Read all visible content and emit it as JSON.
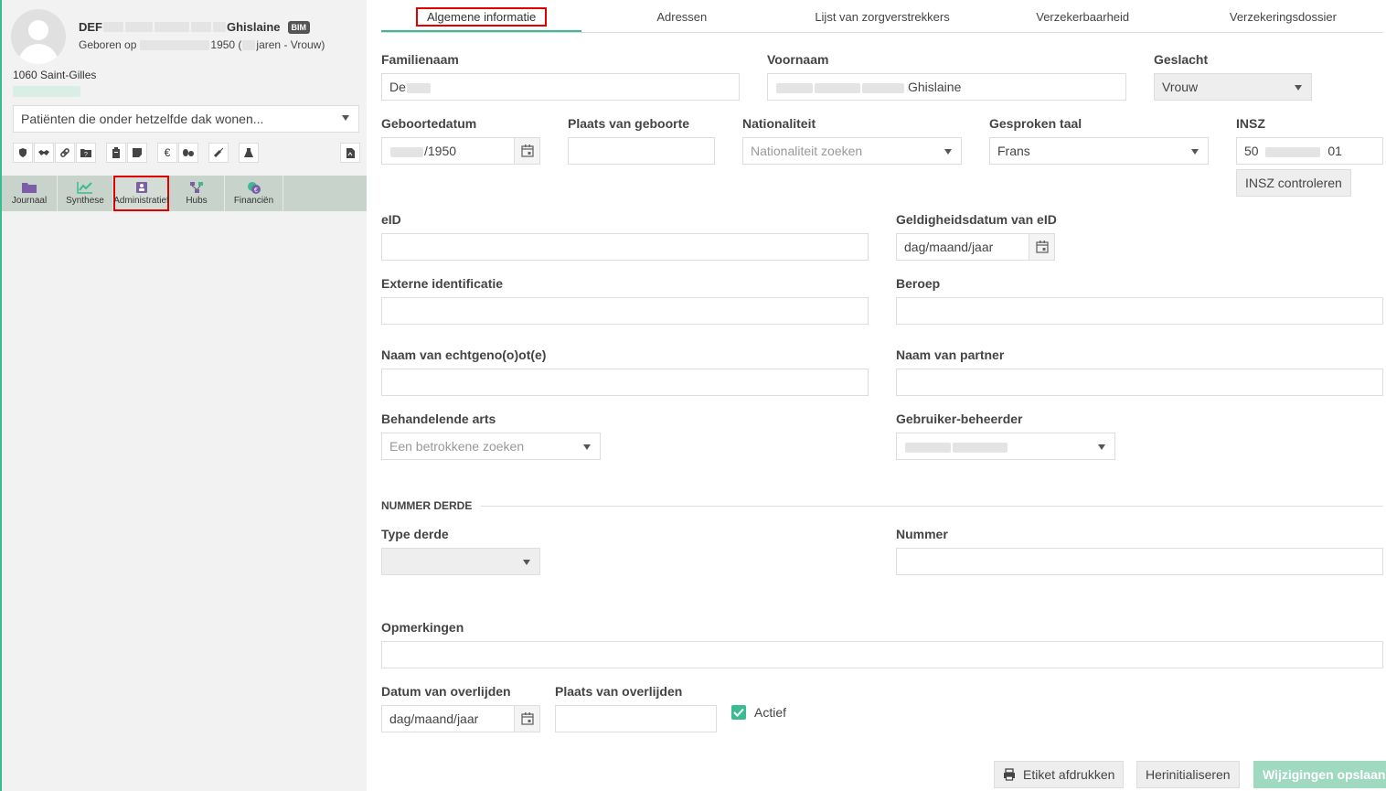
{
  "patient": {
    "name_prefix": "DEF",
    "name_suffix": "Ghislaine",
    "badge": "BIM",
    "birth_prefix": "Geboren op",
    "birth_year": "1950 (",
    "birth_suffix": "jaren - Vrouw)",
    "address": "1060 Saint-Gilles",
    "household_select": "Patiënten die onder hetzelfde dak wonen..."
  },
  "toolbar_icons": [
    "shield-icon",
    "handshake-icon",
    "link-icon",
    "folder-question-icon",
    "clipboard-icon",
    "sticky-note-icon",
    "euro-icon",
    "pills-icon",
    "syringe-icon",
    "flask-icon",
    "pdf-icon"
  ],
  "nav": [
    {
      "label": "Journaal",
      "icon": "folder-icon",
      "color": "#7b5ea7"
    },
    {
      "label": "Synthese",
      "icon": "chart-line-icon",
      "color": "#3cba92"
    },
    {
      "label": "Administratief",
      "icon": "id-card-icon",
      "color": "#7b5ea7"
    },
    {
      "label": "Hubs",
      "icon": "network-icon",
      "color": "#7b5ea7"
    },
    {
      "label": "Financiën",
      "icon": "coins-icon",
      "color": "#3cba92"
    }
  ],
  "tabs": [
    "Algemene informatie",
    "Adressen",
    "Lijst van zorgverstrekkers",
    "Verzekerbaarheid",
    "Verzekeringsdossier"
  ],
  "form": {
    "familienaam": {
      "label": "Familienaam",
      "value": "De"
    },
    "voornaam": {
      "label": "Voornaam",
      "value": "Ghislaine"
    },
    "geslacht": {
      "label": "Geslacht",
      "value": "Vrouw"
    },
    "geboortedatum": {
      "label": "Geboortedatum",
      "value": "/1950"
    },
    "plaats_geboorte": {
      "label": "Plaats van geboorte",
      "value": ""
    },
    "nationaliteit": {
      "label": "Nationaliteit",
      "placeholder": "Nationaliteit zoeken"
    },
    "taal": {
      "label": "Gesproken taal",
      "value": "Frans"
    },
    "insz": {
      "label": "INSZ",
      "value_start": "50",
      "value_end": "01",
      "check_button": "INSZ controleren"
    },
    "eid": {
      "label": "eID",
      "value": ""
    },
    "eid_datum": {
      "label": "Geldigheidsdatum van eID",
      "placeholder": "dag/maand/jaar"
    },
    "externe_id": {
      "label": "Externe identificatie",
      "value": ""
    },
    "beroep": {
      "label": "Beroep",
      "value": ""
    },
    "echtgenoot": {
      "label": "Naam van echtgeno(o)ot(e)",
      "value": ""
    },
    "partner": {
      "label": "Naam van partner",
      "value": ""
    },
    "arts": {
      "label": "Behandelende arts",
      "placeholder": "Een betrokkene zoeken"
    },
    "beheerder": {
      "label": "Gebruiker-beheerder",
      "value": ""
    },
    "section_title": "NUMMER DERDE",
    "type_derde": {
      "label": "Type derde",
      "value": ""
    },
    "nummer": {
      "label": "Nummer",
      "value": ""
    },
    "opmerkingen": {
      "label": "Opmerkingen",
      "value": ""
    },
    "overlijden_datum": {
      "label": "Datum van overlijden",
      "placeholder": "dag/maand/jaar"
    },
    "overlijden_plaats": {
      "label": "Plaats van overlijden",
      "value": ""
    },
    "actief": {
      "label": "Actief",
      "checked": true
    }
  },
  "buttons": {
    "print": "Etiket afdrukken",
    "reset": "Herinitialiseren",
    "save": "Wijzigingen opslaan"
  }
}
